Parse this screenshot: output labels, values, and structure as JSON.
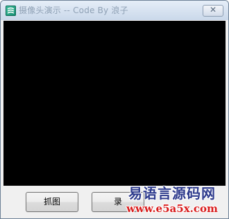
{
  "window": {
    "title": "摄像头演示 -- Code By 浪子",
    "icon": "app-icon",
    "close_symbol": "✕"
  },
  "buttons": {
    "capture_label": "抓图",
    "record_label": "录"
  },
  "watermark": {
    "title": "易语言源码网",
    "url": "www.e5a5x.com"
  },
  "colors": {
    "video_background": "#000000",
    "watermark_title": "#2d3a8c",
    "watermark_url": "#d81b1b"
  }
}
